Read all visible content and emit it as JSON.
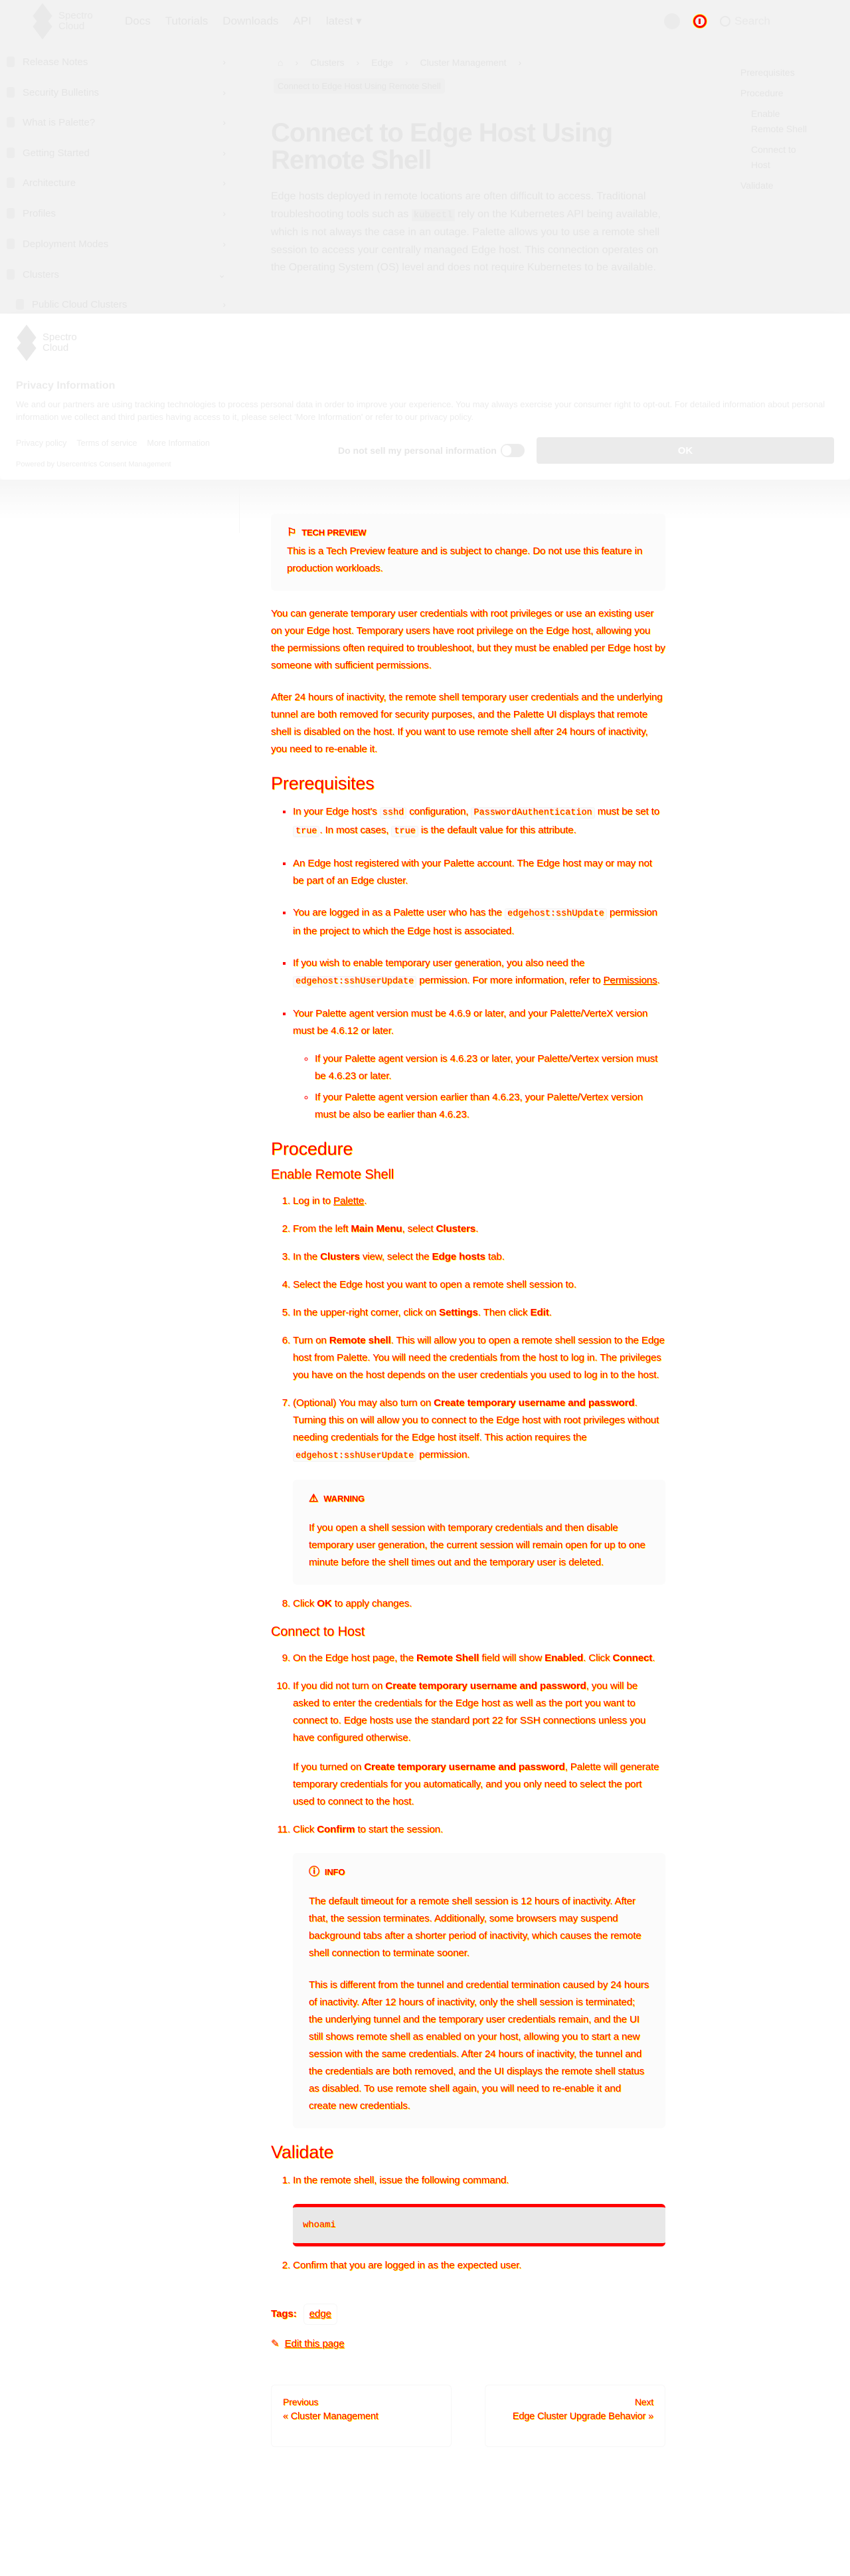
{
  "header": {
    "brand": [
      "Spectro",
      "Cloud"
    ],
    "nav": [
      "Docs",
      "Tutorials",
      "Downloads",
      "API",
      "latest ▾"
    ],
    "search": "Search"
  },
  "sidebar": {
    "items": [
      {
        "label": "Release Notes",
        "chev": "›"
      },
      {
        "label": "Security Bulletins",
        "chev": "›"
      },
      {
        "label": "What is Palette?",
        "chev": "›"
      },
      {
        "label": "Getting Started",
        "chev": "›"
      },
      {
        "label": "Architecture",
        "chev": "›"
      },
      {
        "label": "Profiles",
        "chev": "›"
      },
      {
        "label": "Deployment Modes",
        "chev": "›"
      },
      {
        "label": "Clusters",
        "chev": "⌄"
      },
      {
        "label": "Public Cloud Clusters",
        "chev": "›"
      }
    ]
  },
  "breadcrumb": {
    "items": [
      "Clusters",
      "Edge",
      "Cluster Management"
    ],
    "current": "Connect to Edge Host Using Remote Shell"
  },
  "page": {
    "title": "Connect to Edge Host Using Remote Shell",
    "intro": [
      "Edge hosts deployed in remote locations are often difficult to access. Traditional troubleshooting tools such as ",
      "kubectl",
      " rely on the Kubernetes API being available, which is not always the case in an outage. Palette allows you to use a remote shell session to access your centrally managed Edge host. This connection operates on the Operating System (OS) level and does not require Kubernetes to be available."
    ]
  },
  "toc": [
    "Prerequisites",
    "Procedure",
    "Enable Remote Shell",
    "Connect to Host",
    "Validate"
  ],
  "privacy": {
    "brand": [
      "Spectro",
      "Cloud"
    ],
    "title": "Privacy Information",
    "description": "We and our partners are using tracking technologies to process personal data in order to improve your experience. You may always exercise your consumer right to opt-out. For detailed information about personal information we collect and third parties having access to it, please select 'More Information' or refer to our privacy policy.",
    "links": [
      "Privacy policy",
      "Terms of service",
      "More Information"
    ],
    "powered": "Powered by Usercentrics Consent Management",
    "do_not_sell": "Do not sell my personal information",
    "toggle_state": "X",
    "ok": "OK"
  },
  "content": {
    "blocks": [
      {
        "type": "callout",
        "icon": "⚐",
        "iconName": "flag-icon",
        "title": "TECH PREVIEW",
        "paras": [
          [
            {
              "t": "This is a Tech Preview feature and is subject to change. Do not use this feature in production workloads."
            }
          ]
        ]
      },
      {
        "type": "p",
        "segs": [
          {
            "t": "You can generate temporary user credentials with root privileges or use an existing user on your Edge host. Temporary users have root privilege on the Edge host, allowing you the permissions often required to troubleshoot, but they must be enabled per Edge host by someone with sufficient permissions."
          }
        ]
      },
      {
        "type": "p",
        "segs": [
          {
            "t": "After 24 hours of inactivity, the remote shell temporary user credentials and the underlying tunnel are both removed for security purposes, and the Palette UI displays that remote shell is disabled on the host. If you want to use remote shell after 24 hours of inactivity, you need to re-enable it."
          }
        ]
      },
      {
        "type": "h2",
        "text": "Prerequisites"
      },
      {
        "type": "ul",
        "items": [
          {
            "segs": [
              {
                "t": "In your Edge host's "
              },
              {
                "t": "sshd",
                "s": "c"
              },
              {
                "t": " configuration, "
              },
              {
                "t": "PasswordAuthentication",
                "s": "c"
              },
              {
                "t": " must be set to "
              },
              {
                "t": "true",
                "s": "c"
              },
              {
                "t": ". In most cases, "
              },
              {
                "t": "true",
                "s": "c"
              },
              {
                "t": " is the default value for this attribute."
              }
            ]
          },
          {
            "segs": [
              {
                "t": "An Edge host registered with your Palette account. The Edge host may or may not be part of an Edge cluster."
              }
            ]
          },
          {
            "segs": [
              {
                "t": "You are logged in as a Palette user who has the "
              },
              {
                "t": "edgehost:sshUpdate",
                "s": "c"
              },
              {
                "t": " permission in the project to which the Edge host is associated."
              }
            ]
          },
          {
            "segs": [
              {
                "t": "If you wish to enable temporary user generation, you also need the "
              },
              {
                "t": "edgehost:sshUserUpdate",
                "s": "c"
              },
              {
                "t": " permission. For more information, refer to "
              },
              {
                "t": "Permissions",
                "s": "a"
              },
              {
                "t": "."
              }
            ]
          },
          {
            "segs": [
              {
                "t": "Your Palette agent version must be 4.6.9 or later, and your Palette/VerteX version must be 4.6.12 or later."
              }
            ],
            "sub": [
              [
                {
                  "t": "If your Palette agent version is 4.6.23 or later, your Palette/Vertex version must be 4.6.23 or later."
                }
              ],
              [
                {
                  "t": "If your Palette agent version earlier than 4.6.23, your Palette/Vertex version must be also be earlier than 4.6.23."
                }
              ]
            ]
          }
        ]
      },
      {
        "type": "h2",
        "text": "Procedure"
      },
      {
        "type": "h3",
        "text": "Enable Remote Shell"
      },
      {
        "type": "ol",
        "start": 1,
        "items": [
          {
            "segs": [
              {
                "t": "Log in to "
              },
              {
                "t": "Palette",
                "s": "a"
              },
              {
                "t": "."
              }
            ]
          },
          {
            "segs": [
              {
                "t": "From the left "
              },
              {
                "t": "Main Menu",
                "s": "b"
              },
              {
                "t": ", select "
              },
              {
                "t": "Clusters",
                "s": "b"
              },
              {
                "t": "."
              }
            ]
          },
          {
            "segs": [
              {
                "t": "In the "
              },
              {
                "t": "Clusters",
                "s": "b"
              },
              {
                "t": " view, select the "
              },
              {
                "t": "Edge hosts",
                "s": "b"
              },
              {
                "t": " tab."
              }
            ]
          },
          {
            "segs": [
              {
                "t": "Select the Edge host you want to open a remote shell session to."
              }
            ]
          },
          {
            "segs": [
              {
                "t": "In the upper-right corner, click on "
              },
              {
                "t": "Settings",
                "s": "b"
              },
              {
                "t": ". Then click "
              },
              {
                "t": "Edit",
                "s": "b"
              },
              {
                "t": "."
              }
            ]
          },
          {
            "segs": [
              {
                "t": "Turn on "
              },
              {
                "t": "Remote shell",
                "s": "b"
              },
              {
                "t": ". This will allow you to open a remote shell session to the Edge host from Palette. You will need the credentials from the host to log in. The privileges you have on the host depends on the user credentials you used to log in to the host."
              }
            ]
          },
          {
            "segs": [
              {
                "t": "(Optional) You may also turn on "
              },
              {
                "t": "Create temporary username and password",
                "s": "b"
              },
              {
                "t": ". Turning this on will allow you to connect to the Edge host with root privileges without needing credentials for the Edge host itself. This action requires the "
              },
              {
                "t": "edgehost:sshUserUpdate",
                "s": "c"
              },
              {
                "t": " permission."
              }
            ],
            "callout": {
              "icon": "⚠",
              "iconName": "warning-icon",
              "title": "WARNING",
              "paras": [
                [
                  {
                    "t": "If you open a shell session with temporary credentials and then disable temporary user generation, the current session will remain open for up to one minute before the shell times out and the temporary user is deleted."
                  }
                ]
              ]
            }
          },
          {
            "segs": [
              {
                "t": "Click "
              },
              {
                "t": "OK",
                "s": "b"
              },
              {
                "t": " to apply changes."
              }
            ]
          }
        ]
      },
      {
        "type": "h3",
        "text": "Connect to Host"
      },
      {
        "type": "ol",
        "start": 9,
        "items": [
          {
            "segs": [
              {
                "t": "On the Edge host page, the "
              },
              {
                "t": "Remote Shell",
                "s": "b"
              },
              {
                "t": " field will show "
              },
              {
                "t": "Enabled",
                "s": "b"
              },
              {
                "t": ". Click "
              },
              {
                "t": "Connect",
                "s": "b"
              },
              {
                "t": "."
              }
            ]
          },
          {
            "segs": [
              {
                "t": "If you did not turn on "
              },
              {
                "t": "Create temporary username and password",
                "s": "b"
              },
              {
                "t": ", you will be asked to enter the credentials for the Edge host as well as the port you want to connect to. Edge hosts use the standard port 22 for SSH connections unless you have configured otherwise."
              }
            ],
            "paras": [
              [
                {
                  "t": "If you turned on "
                },
                {
                  "t": "Create temporary username and password",
                  "s": "b"
                },
                {
                  "t": ", Palette will generate temporary credentials for you automatically, and you only need to select the port used to connect to the host."
                }
              ]
            ]
          },
          {
            "segs": [
              {
                "t": "Click "
              },
              {
                "t": "Confirm",
                "s": "b"
              },
              {
                "t": " to start the session."
              }
            ],
            "callout": {
              "icon": "ⓘ",
              "iconName": "info-icon",
              "title": "INFO",
              "paras": [
                [
                  {
                    "t": "The default timeout for a remote shell session is 12 hours of inactivity. After that, the session terminates. Additionally, some browsers may suspend background tabs after a shorter period of inactivity, which causes the remote shell connection to terminate sooner."
                  }
                ],
                [
                  {
                    "t": "This is different from the tunnel and credential termination caused by 24 hours of inactivity. After 12 hours of inactivity, only the shell session is terminated; the underlying tunnel and the temporary user credentials remain, and the UI still shows remote shell as enabled on your host, allowing you to start a new session with the same credentials. After 24 hours of inactivity, the tunnel and the credentials are both removed, and the UI displays the remote shell status as disabled. To use remote shell again, you will need to re-enable it and create new credentials."
                  }
                ]
              ]
            }
          }
        ]
      },
      {
        "type": "h2",
        "text": "Validate"
      },
      {
        "type": "ol",
        "start": 1,
        "items": [
          {
            "segs": [
              {
                "t": "In the remote shell, issue the following command."
              }
            ],
            "code": "whoami"
          },
          {
            "segs": [
              {
                "t": "Confirm that you are logged in as the expected user."
              }
            ]
          }
        ]
      }
    ]
  },
  "footer": {
    "tags_label": "Tags:",
    "tags": [
      "edge"
    ],
    "edit": "Edit this page",
    "prev": {
      "label": "Previous",
      "title": "« Cluster Management"
    },
    "next": {
      "label": "Next",
      "title": "Edge Cluster Upgrade Behavior »"
    }
  }
}
